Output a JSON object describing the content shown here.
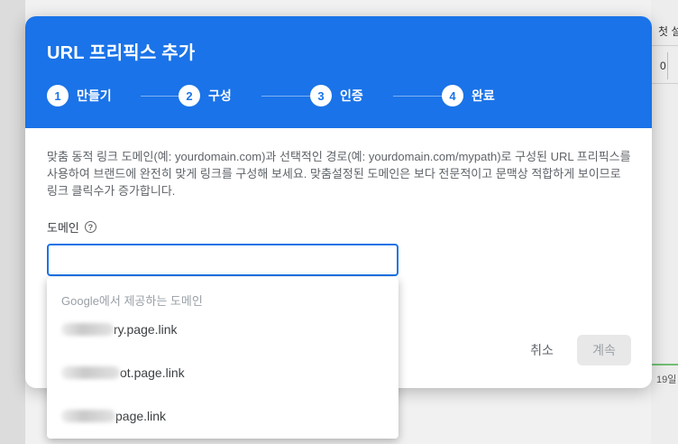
{
  "background": {
    "right_header": "첫 설",
    "right_value": "0",
    "right_date": "19일"
  },
  "dialog": {
    "title": "URL 프리픽스 추가",
    "steps": [
      {
        "number": "1",
        "label": "만들기"
      },
      {
        "number": "2",
        "label": "구성"
      },
      {
        "number": "3",
        "label": "인증"
      },
      {
        "number": "4",
        "label": "완료"
      }
    ],
    "description": "맞춤 동적 링크 도메인(예: yourdomain.com)과 선택적인 경로(예: yourdomain.com/mypath)로 구성된 URL 프리픽스를 사용하여 브랜드에 완전히 맞게 링크를 구성해 보세요. 맞춤설정된 도메인은 보다 전문적이고 문맥상 적합하게 보이므로 링크 클릭수가 증가합니다.",
    "domain_label": "도메인",
    "help_icon": "?",
    "domain_value": "",
    "cancel_label": "취소",
    "continue_label": "계속"
  },
  "dropdown": {
    "header": "Google에서 제공하는 도메인",
    "options": [
      {
        "text": "ry.page.link"
      },
      {
        "text": "ot.page.link"
      },
      {
        "text": "page.link"
      }
    ]
  },
  "colors": {
    "header_blue": "#1a73e8",
    "text_gray": "#5f6368",
    "disabled_button": "#e8e8e8"
  },
  "icons": {
    "help": "help-circle-icon"
  }
}
